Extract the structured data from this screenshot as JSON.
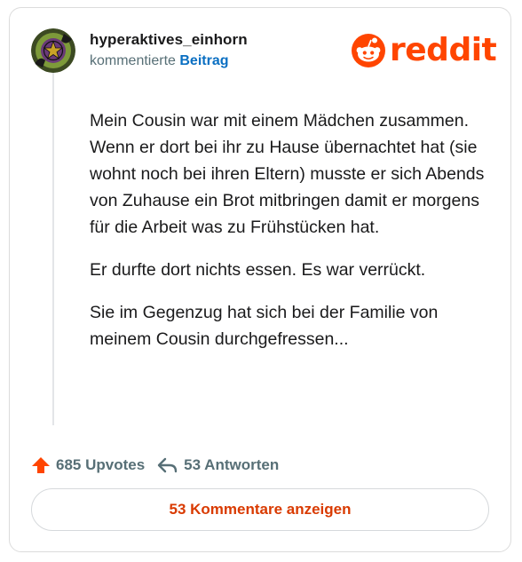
{
  "post": {
    "username": "hyperaktives_einhorn",
    "action_text": "kommentierte",
    "target_link": "Beitrag",
    "brand": "reddit",
    "paragraphs": [
      "Mein Cousin war mit einem Mädchen zusammen. Wenn er dort bei ihr zu Hause übernachtet hat (sie wohnt noch bei ihren Eltern) musste er sich Abends von Zuhause ein Brot mitbringen damit er morgens für die Arbeit was zu Frühstücken hat.",
      "Er durfte dort nichts essen. Es war verrückt.",
      "Sie im Gegenzug hat sich bei der Familie von meinem Cousin durchgefressen..."
    ]
  },
  "stats": {
    "upvotes": "685 Upvotes",
    "replies": "53 Antworten"
  },
  "actions": {
    "view_comments": "53 Kommentare anzeigen"
  },
  "icons": {
    "avatar": "pentagram-avatar",
    "logo": "reddit-snoo-icon",
    "upvote": "upvote-arrow-icon",
    "reply": "reply-arrow-icon"
  },
  "colors": {
    "brand": "#ff4500",
    "link": "#0a6fc2",
    "muted": "#576f76",
    "comments_button_text": "#d93a00"
  }
}
